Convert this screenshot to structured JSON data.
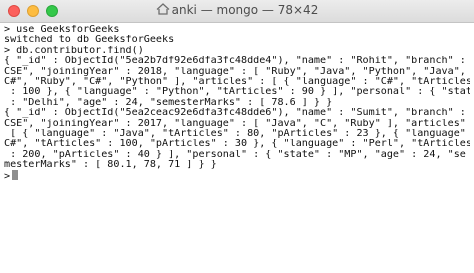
{
  "window": {
    "title": "anki — mongo — 78×42",
    "home_icon": "home-icon",
    "buttons": [
      "close",
      "minimize",
      "maximize"
    ]
  },
  "terminal": {
    "lines": [
      "> use GeeksforGeeks",
      "switched to db GeeksforGeeks",
      "> db.contributor.find()",
      "{ \"_id\" : ObjectId(\"5ea2b7df92e6dfa3fc48dde4\"), \"name\" : \"Rohit\", \"branch\" : \"",
      "CSE\", \"joiningYear\" : 2018, \"language\" : [ \"Ruby\", \"Java\", \"Python\", \"Java\", \"",
      "C#\", \"Ruby\", \"C#\", \"Python\" ], \"articles\" : [ { \"language\" : \"C#\", \"tArticles\"",
      " : 100 }, { \"language\" : \"Python\", \"tArticles\" : 90 } ], \"personal\" : { \"state\"",
      " : \"Delhi\", \"age\" : 24, \"semesterMarks\" : [ 78.6 ] } }",
      "{ \"_id\" : ObjectId(\"5ea2ceac92e6dfa3fc48dde6\"), \"name\" : \"Sumit\", \"branch\" : \"",
      "CSE\", \"joiningYear\" : 2017, \"language\" : [ \"Java\", \"C\", \"Ruby\" ], \"articles\" :",
      " [ { \"language\" : \"Java\", \"tArticles\" : 80, \"pArticles\" : 23 }, { \"language\" : \"",
      "C#\", \"tArticles\" : 100, \"pArticles\" : 30 }, { \"language\" : \"Perl\", \"tArticles\"",
      " : 200, \"pArticles\" : 40 } ], \"personal\" : { \"state\" : \"MP\", \"age\" : 24, \"se",
      "mesterMarks\" : [ 80.1, 78, 71 ] } }"
    ],
    "prompt": ">"
  }
}
